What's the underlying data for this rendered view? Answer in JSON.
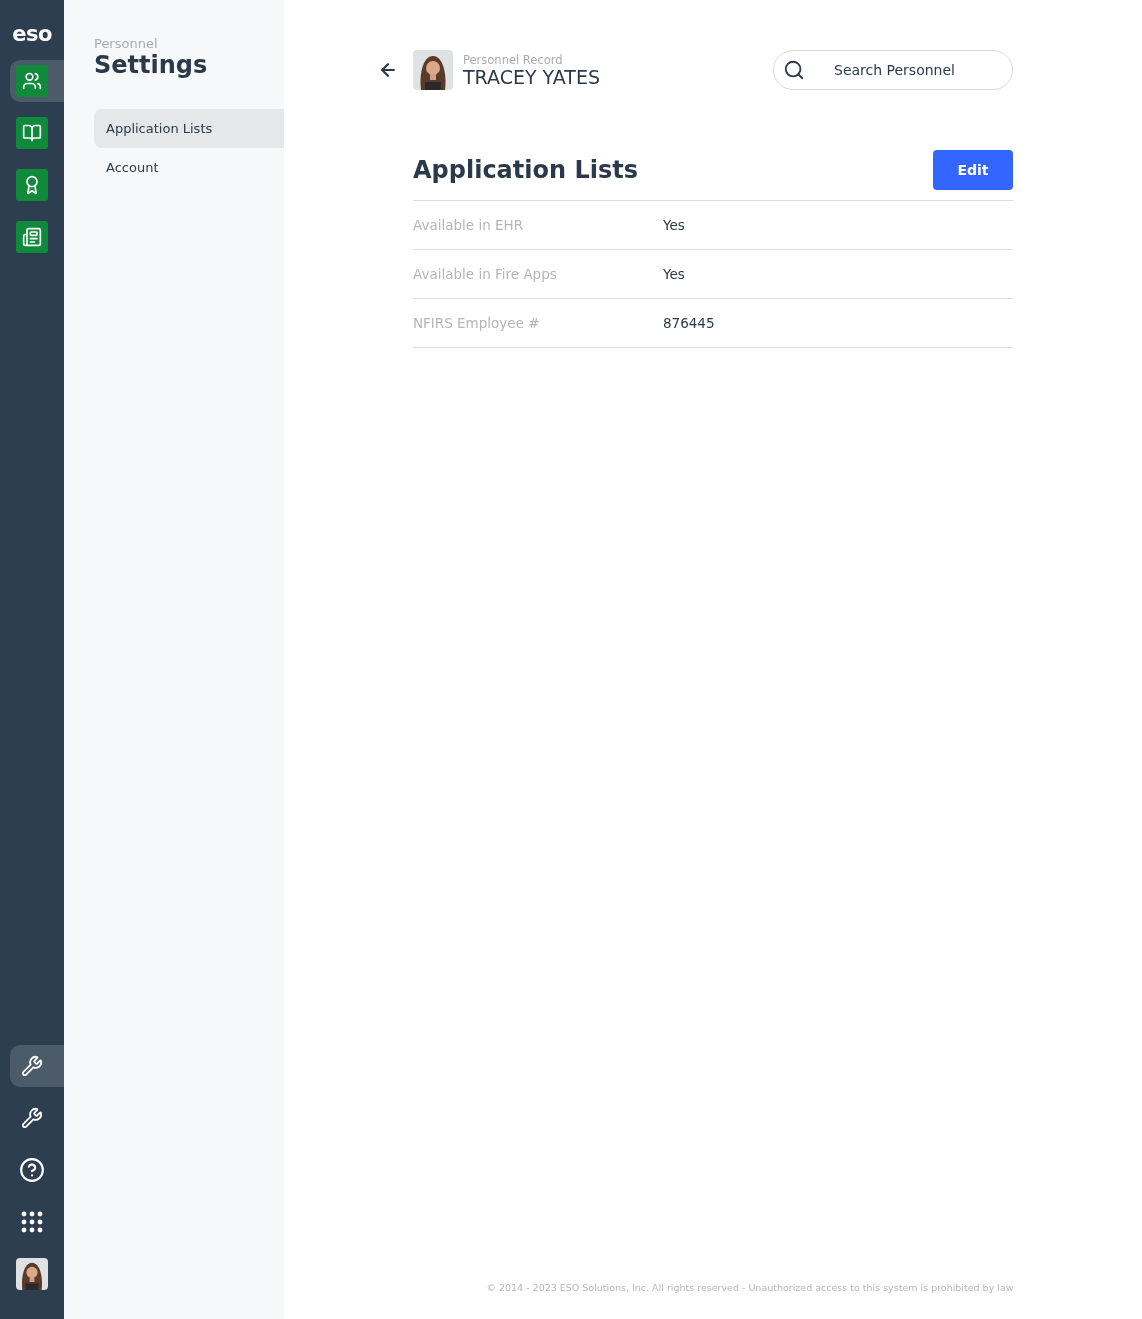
{
  "rail": {
    "logo": "eso",
    "top_items": [
      {
        "kind": "people",
        "selected": true
      },
      {
        "kind": "book",
        "selected": false
      },
      {
        "kind": "award",
        "selected": false
      },
      {
        "kind": "news",
        "selected": false
      }
    ],
    "bottom_items": [
      {
        "kind": "wrench",
        "selected": true
      },
      {
        "kind": "wrench",
        "selected": false
      },
      {
        "kind": "help",
        "selected": false
      },
      {
        "kind": "apps",
        "selected": false
      },
      {
        "kind": "avatar",
        "selected": false
      }
    ]
  },
  "sidebar": {
    "section": "Personnel",
    "title": "Settings",
    "items": [
      {
        "label": "Application Lists",
        "selected": true
      },
      {
        "label": "Account",
        "selected": false
      }
    ]
  },
  "header": {
    "caption": "Personnel Record",
    "name": "TRACEY YATES",
    "search": {
      "placeholder": "Search Personnel"
    }
  },
  "panel": {
    "title": "Application Lists",
    "button": "Edit",
    "rows": [
      {
        "label": "Available in EHR",
        "value": "Yes"
      },
      {
        "label": "Available in Fire Apps",
        "value": "Yes"
      },
      {
        "label": "NFIRS Employee #",
        "value": "876445"
      }
    ]
  },
  "footer": "© 2014 - 2023 ESO Solutions, Inc. All rights reserved - Unauthorized access to this system is prohibited by law"
}
